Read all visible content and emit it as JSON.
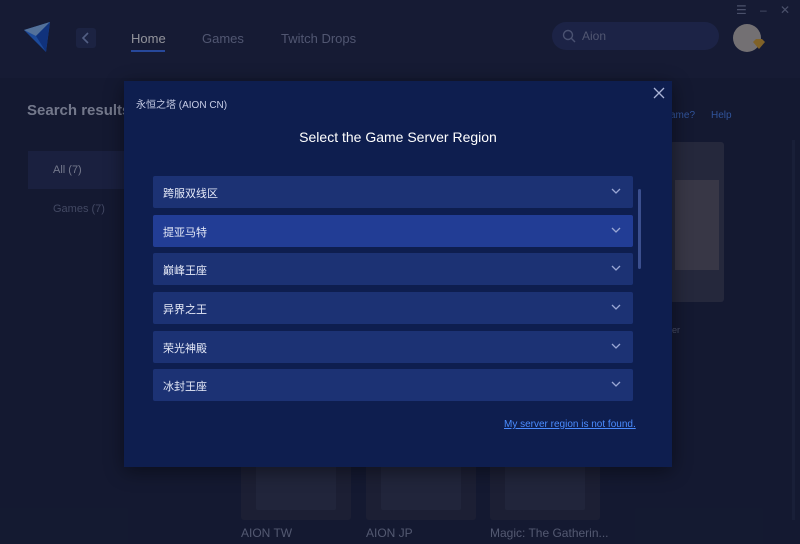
{
  "header": {
    "nav": [
      "Home",
      "Games",
      "Twitch Drops"
    ],
    "search_value": "Aion"
  },
  "sidebar": {
    "title": "Search results",
    "items": [
      "All (7)",
      "Games (7)"
    ]
  },
  "background": {
    "help_links": [
      "ame?",
      "Help"
    ],
    "cards": [
      "AION TW",
      "AION JP",
      "Magic: The Gatherin..."
    ],
    "poster_caption": "er"
  },
  "modal": {
    "game_name": "永恒之塔 (AION CN)",
    "title": "Select the Game Server Region",
    "regions": [
      "跨服双线区",
      "提亚马特",
      "巅峰王座",
      "异界之王",
      "荣光神殿",
      "冰封王座"
    ],
    "not_found_link": "My server region is not found."
  },
  "colors": {
    "accent": "#3f78ff",
    "modal_bg": "#0e1e4f",
    "row_bg": "#1c3274",
    "row_highlight": "#223d95",
    "link": "#4a8cff"
  },
  "icons": {
    "logo": "app-logo-icon",
    "back": "chevron-left-icon",
    "search": "search-icon",
    "close": "close-icon",
    "expand": "chevron-down-icon"
  }
}
